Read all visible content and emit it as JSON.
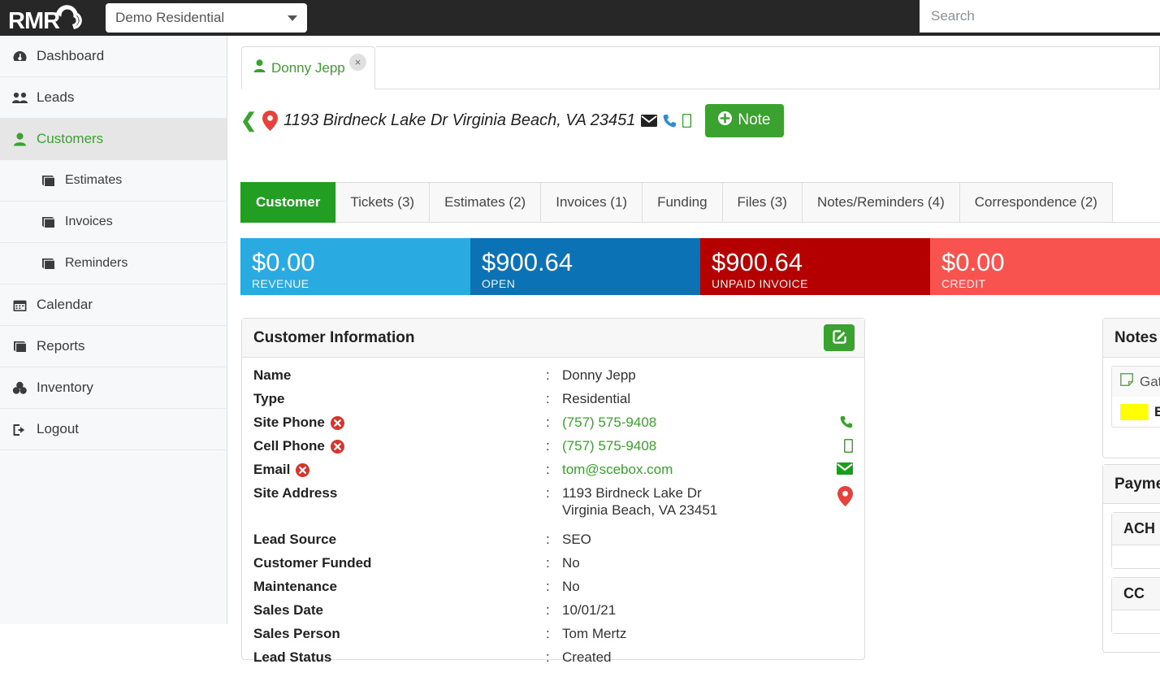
{
  "topbar": {
    "logo_text": "RMR",
    "org_selected": "Demo Residential",
    "search_placeholder": "Search"
  },
  "sidebar": {
    "items": [
      {
        "label": "Dashboard",
        "icon": "dashboard-icon",
        "active": false,
        "sub": false
      },
      {
        "label": "Leads",
        "icon": "users-icon",
        "active": false,
        "sub": false
      },
      {
        "label": "Customers",
        "icon": "user-icon",
        "active": true,
        "sub": false
      },
      {
        "label": "Estimates",
        "icon": "book-icon",
        "active": false,
        "sub": true
      },
      {
        "label": "Invoices",
        "icon": "book-icon",
        "active": false,
        "sub": true
      },
      {
        "label": "Reminders",
        "icon": "book-icon",
        "active": false,
        "sub": true
      },
      {
        "label": "Calendar",
        "icon": "calendar-icon",
        "active": false,
        "sub": false
      },
      {
        "label": "Reports",
        "icon": "book-icon",
        "active": false,
        "sub": false
      },
      {
        "label": "Inventory",
        "icon": "boxes-icon",
        "active": false,
        "sub": false
      },
      {
        "label": "Logout",
        "icon": "logout-icon",
        "active": false,
        "sub": false
      }
    ]
  },
  "doc_tab": {
    "label": "Donny Jepp",
    "close": "×"
  },
  "address_bar": {
    "address": "1193 Birdneck Lake Dr Virginia Beach, VA 23451",
    "note_button": "Note"
  },
  "main_tabs": [
    {
      "label": "Customer",
      "active": true
    },
    {
      "label": "Tickets (3)",
      "active": false
    },
    {
      "label": "Estimates (2)",
      "active": false
    },
    {
      "label": "Invoices (1)",
      "active": false
    },
    {
      "label": "Funding",
      "active": false
    },
    {
      "label": "Files (3)",
      "active": false
    },
    {
      "label": "Notes/Reminders (4)",
      "active": false
    },
    {
      "label": "Correspondence (2)",
      "active": false
    }
  ],
  "stats": [
    {
      "amount": "$0.00",
      "label": "REVENUE",
      "color": "#29abe2"
    },
    {
      "amount": "$900.64",
      "label": "OPEN",
      "color": "#0b72b5"
    },
    {
      "amount": "$900.64",
      "label": "UNPAID INVOICE",
      "color": "#b50000"
    },
    {
      "amount": "$0.00",
      "label": "CREDIT",
      "color": "#f9534f"
    }
  ],
  "customer_information": {
    "title": "Customer Information",
    "rows": [
      {
        "label": "Name",
        "value": "Donny Jepp",
        "link": false,
        "warn": false,
        "icon": ""
      },
      {
        "label": "Type",
        "value": "Residential",
        "link": false,
        "warn": false,
        "icon": ""
      },
      {
        "label": "Site Phone",
        "value": "(757) 575-9408",
        "link": true,
        "warn": true,
        "icon": "phone-icon"
      },
      {
        "label": "Cell Phone",
        "value": "(757) 575-9408",
        "link": true,
        "warn": true,
        "icon": "mobile-icon"
      },
      {
        "label": "Email",
        "value": "tom@scebox.com",
        "link": true,
        "warn": true,
        "icon": "envelope-icon"
      },
      {
        "label": "Site Address",
        "value": "1193 Birdneck Lake Dr\nVirginia Beach, VA 23451",
        "link": false,
        "warn": false,
        "icon": "map-pin-icon"
      },
      {
        "label": "Lead Source",
        "value": "SEO",
        "link": false,
        "warn": false,
        "icon": ""
      },
      {
        "label": "Customer Funded",
        "value": "No",
        "link": false,
        "warn": false,
        "icon": ""
      },
      {
        "label": "Maintenance",
        "value": "No",
        "link": false,
        "warn": false,
        "icon": ""
      },
      {
        "label": "Sales Date",
        "value": "10/01/21",
        "link": false,
        "warn": false,
        "icon": ""
      },
      {
        "label": "Sales Person",
        "value": "Tom Mertz",
        "link": false,
        "warn": false,
        "icon": ""
      },
      {
        "label": "Lead Status",
        "value": "Created",
        "link": false,
        "warn": false,
        "icon": ""
      }
    ]
  },
  "notes_overview": {
    "title": "Notes Overview",
    "rows": [
      {
        "label": "Gate Code",
        "type": "note-icon",
        "bold": false
      },
      {
        "label": "Estimate",
        "type": "swatch",
        "bold": true,
        "swatch_color": "#ffff00"
      }
    ]
  },
  "payment_methods": {
    "title": "Payment Methods",
    "cards": [
      {
        "label": "ACH"
      },
      {
        "label": "CC"
      }
    ]
  }
}
